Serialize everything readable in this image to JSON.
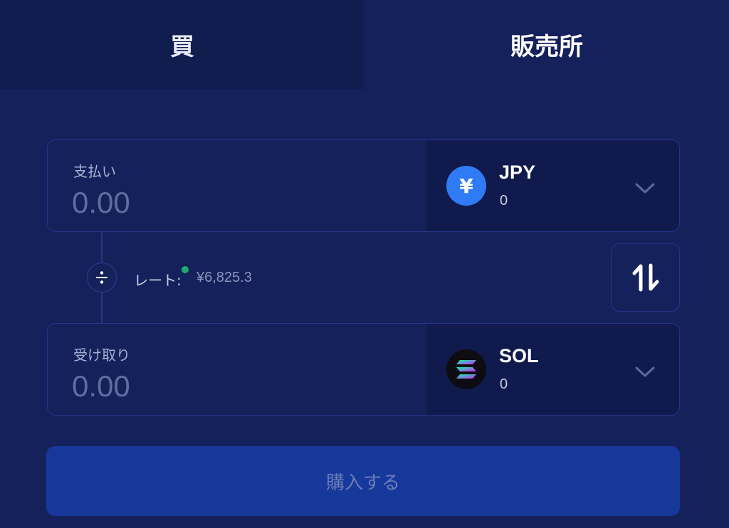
{
  "tabs": [
    {
      "label": "買",
      "active": false
    },
    {
      "label": "販売所",
      "active": true
    }
  ],
  "pay": {
    "label": "支払い",
    "placeholder": "0.00",
    "currency": {
      "code": "JPY",
      "balance": "0",
      "icon_glyph": "¥",
      "icon": "yen-coin-icon"
    }
  },
  "rate": {
    "label": "レート:",
    "value": "¥6,825.3",
    "status_color": "#1fa971"
  },
  "receive": {
    "label": "受け取り",
    "placeholder": "0.00",
    "currency": {
      "code": "SOL",
      "balance": "0",
      "icon": "solana-coin-icon"
    }
  },
  "actions": {
    "buy_label": "購入する",
    "swap_icon": "swap-arrows-icon"
  },
  "colors": {
    "background": "#15215b",
    "accent_blue": "#2f7bf5",
    "buy_button": "#17389b"
  }
}
